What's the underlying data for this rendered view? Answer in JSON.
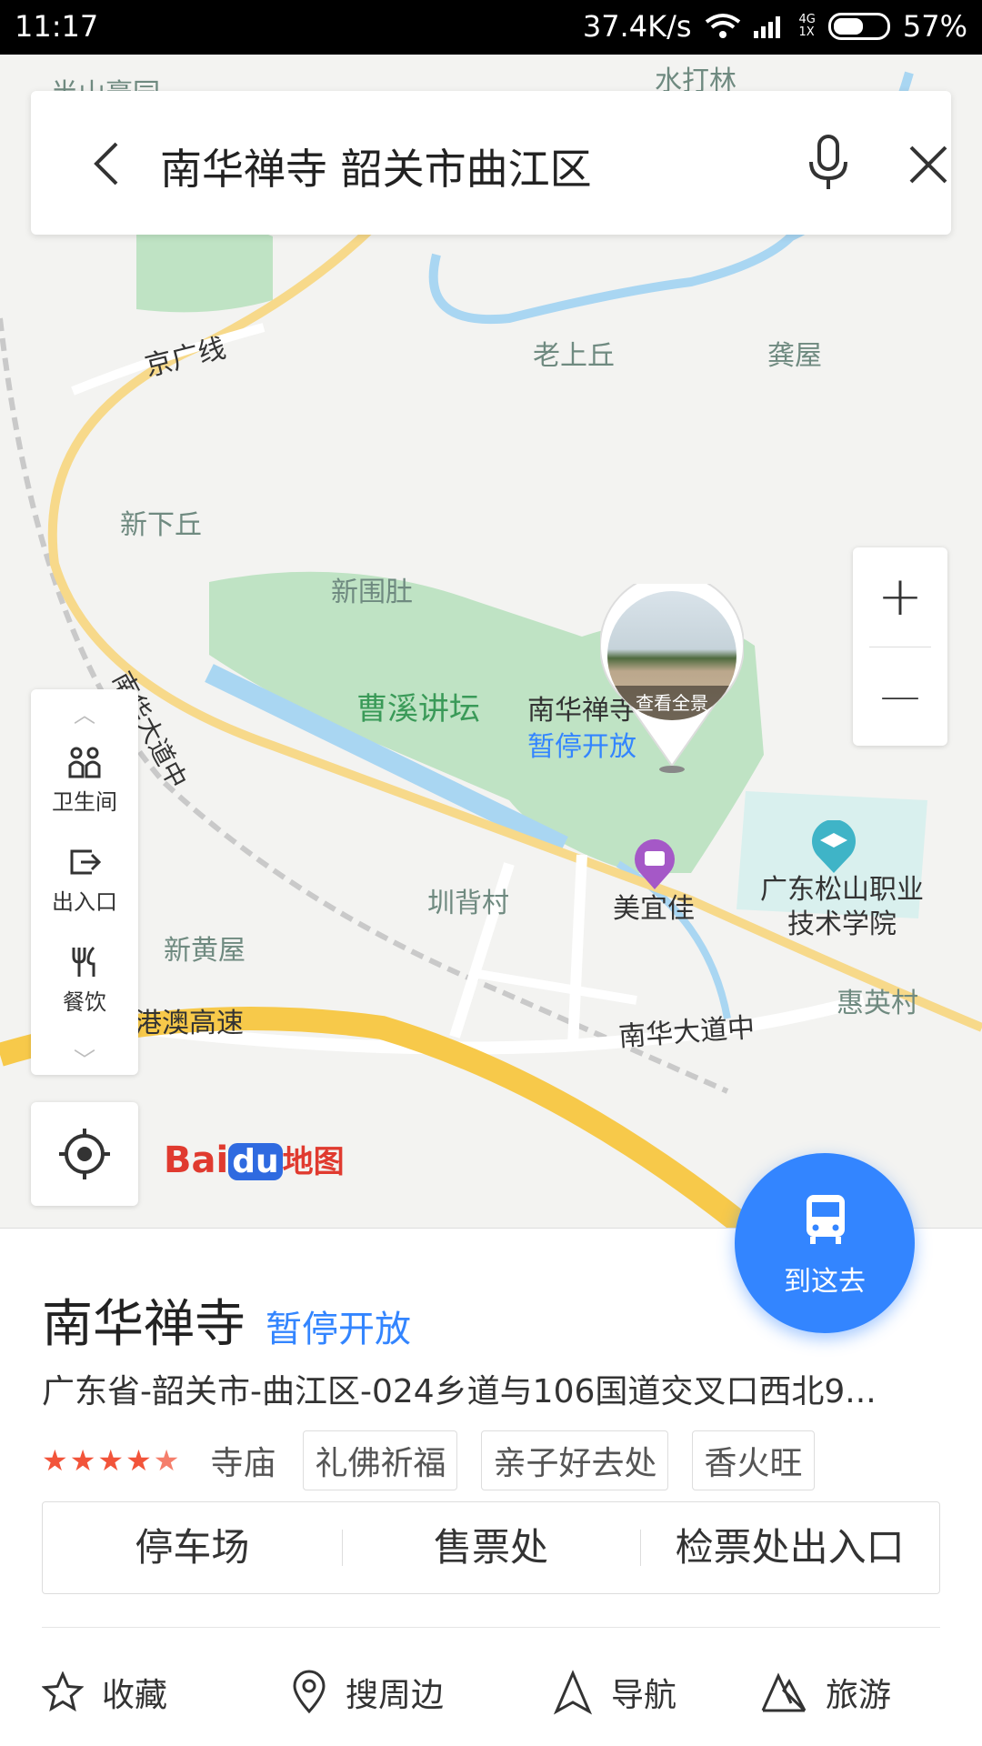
{
  "status_bar": {
    "time": "11:17",
    "speed": "37.4K/s",
    "net_top": "4G",
    "net_bottom": "1X",
    "battery": "57%",
    "battery_level": 0.57
  },
  "search": {
    "query": "南华禅寺 韶关市曲江区"
  },
  "map": {
    "labels": {
      "banshan": "半山豪园",
      "shuidalin": "水打林",
      "jingguang": "京广线",
      "laoshangqiu": "老上丘",
      "gongwu": "龚屋",
      "xinxiaqiu": "新下丘",
      "xinweidu": "新围肚",
      "caoxi": "曹溪讲坛",
      "poi_name": "南华禅寺",
      "poi_status": "暂停开放",
      "nanhua_road_v": "南华大道中",
      "zhenbeicun": "圳背村",
      "meiyijia": "美宜佳",
      "college": "广东松山职业技术学院",
      "xinhuangwu": "新黄屋",
      "expressway": "港澳高速",
      "nanhua_road": "南华大道中",
      "huiyingcun": "惠英村",
      "panorama": "查看全景"
    },
    "zoom_in": "+",
    "zoom_out": "—",
    "side_panel": {
      "items": [
        {
          "label": "卫生间",
          "icon": "restroom-icon"
        },
        {
          "label": "出入口",
          "icon": "exit-icon"
        },
        {
          "label": "餐饮",
          "icon": "restaurant-icon"
        }
      ]
    },
    "logo": {
      "bai": "Bai",
      "du": "du",
      "word": "地图"
    }
  },
  "place": {
    "name": "南华禅寺",
    "status": "暂停开放",
    "address": "广东省-韶关市-曲江区-024乡道与106国道交叉口西北9...",
    "rating": 4.5,
    "category": "寺庙",
    "tags": [
      "礼佛祈福",
      "亲子好去处",
      "香火旺"
    ],
    "sub_pois": [
      "停车场",
      "售票处",
      "检票处出入口"
    ],
    "go_label": "到这去"
  },
  "actions": {
    "favorite": "收藏",
    "nearby": "搜周边",
    "navigate": "导航",
    "travel": "旅游"
  },
  "colors": {
    "accent": "#3385ff",
    "star": "#f2543a",
    "park": "#bfe3c4",
    "water": "#a9d6f2",
    "highway": "#f7c94a"
  }
}
